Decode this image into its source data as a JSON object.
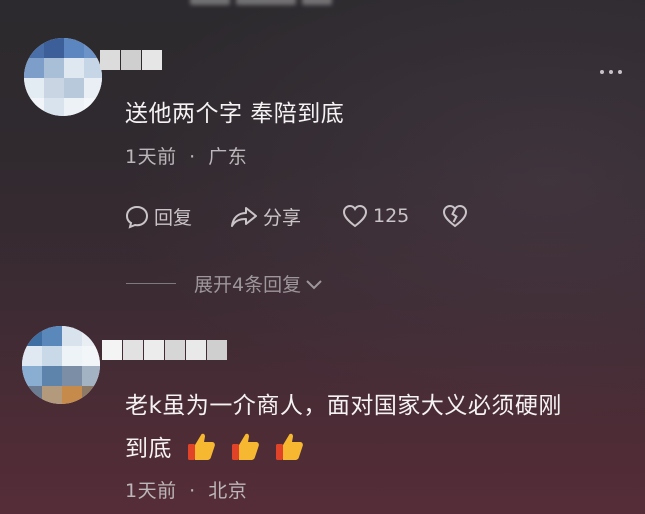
{
  "comments": [
    {
      "text": "送他两个字 奉陪到底",
      "time": "1天前",
      "separator": "·",
      "location": "广东",
      "actions": {
        "reply_label": "回复",
        "share_label": "分享",
        "like_count": "125"
      },
      "expand_label": "展开4条回复"
    },
    {
      "text_line1": "老k虽为一介商人，面对国家大义必须硬刚",
      "text_line2": "到底",
      "time": "1天前",
      "separator": "·",
      "location": "北京"
    }
  ],
  "icons": {
    "more": "more-dots-icon",
    "reply": "comment-bubble-icon",
    "share": "share-arrow-icon",
    "like": "heart-icon",
    "dislike": "broken-heart-icon",
    "expand": "chevron-down-icon",
    "emoji": "thumbs-up-emoji"
  },
  "colors": {
    "text_primary": "#f4f2f3",
    "text_meta": "#bcb7ba",
    "background_top": "#2c2a2e",
    "background_bottom": "#552d38",
    "emoji_thumb": "#f6b830"
  }
}
